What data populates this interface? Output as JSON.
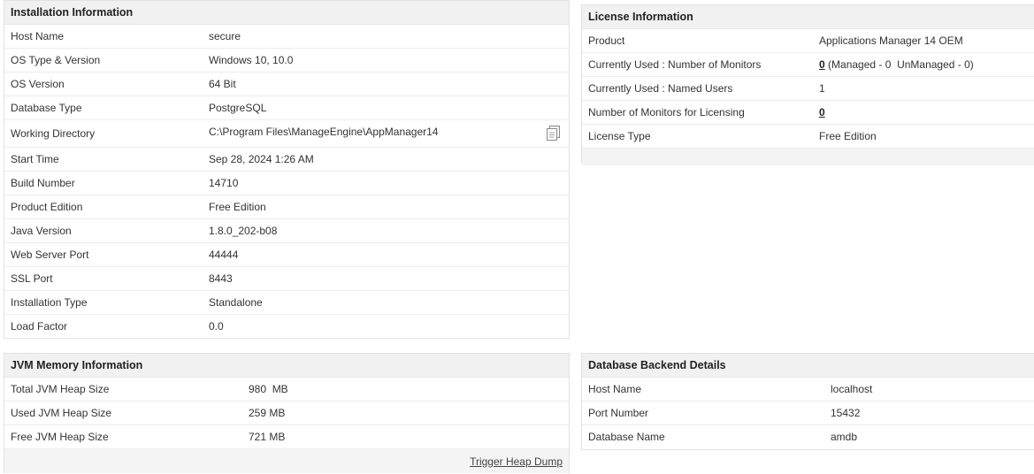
{
  "installation": {
    "title": "Installation Information",
    "rows": [
      {
        "label": "Host Name",
        "value": "secure"
      },
      {
        "label": "OS Type & Version",
        "value": "Windows 10, 10.0"
      },
      {
        "label": "OS Version",
        "value": "64 Bit"
      },
      {
        "label": "Database Type",
        "value": "PostgreSQL"
      },
      {
        "label": "Working Directory",
        "value": "C:\\Program Files\\ManageEngine\\AppManager14"
      },
      {
        "label": "Start Time",
        "value": "Sep 28, 2024 1:26 AM"
      },
      {
        "label": "Build Number",
        "value": "14710"
      },
      {
        "label": "Product Edition",
        "value": "Free Edition"
      },
      {
        "label": "Java Version",
        "value": "1.8.0_202-b08"
      },
      {
        "label": "Web Server Port",
        "value": "44444"
      },
      {
        "label": "SSL Port",
        "value": "8443"
      },
      {
        "label": "Installation Type",
        "value": "Standalone"
      },
      {
        "label": "Load Factor",
        "value": "0.0"
      }
    ],
    "copy_icon": "copy-icon"
  },
  "license": {
    "title": "License Information",
    "product_label": "Product",
    "product_value": "Applications Manager 14 OEM",
    "monitors_label": "Currently Used : Number of Monitors",
    "monitors_count": "0",
    "monitors_detail": "(Managed - 0  UnManaged - 0)",
    "users_label": "Currently Used : Named Users",
    "users_value": "1",
    "licensing_label": "Number of Monitors for Licensing",
    "licensing_value": "0",
    "type_label": "License Type",
    "type_value": "Free Edition"
  },
  "jvm": {
    "title": "JVM Memory Information",
    "rows": [
      {
        "label": "Total JVM Heap Size",
        "value": "980  MB"
      },
      {
        "label": "Used JVM Heap Size",
        "value": "259 MB"
      },
      {
        "label": "Free JVM Heap Size",
        "value": "721 MB"
      }
    ],
    "heap_dump_link": "Trigger Heap Dump"
  },
  "database": {
    "title": "Database Backend Details",
    "rows": [
      {
        "label": "Host Name",
        "value": "localhost"
      },
      {
        "label": "Port Number",
        "value": "15432"
      },
      {
        "label": "Database Name",
        "value": "amdb"
      }
    ]
  }
}
